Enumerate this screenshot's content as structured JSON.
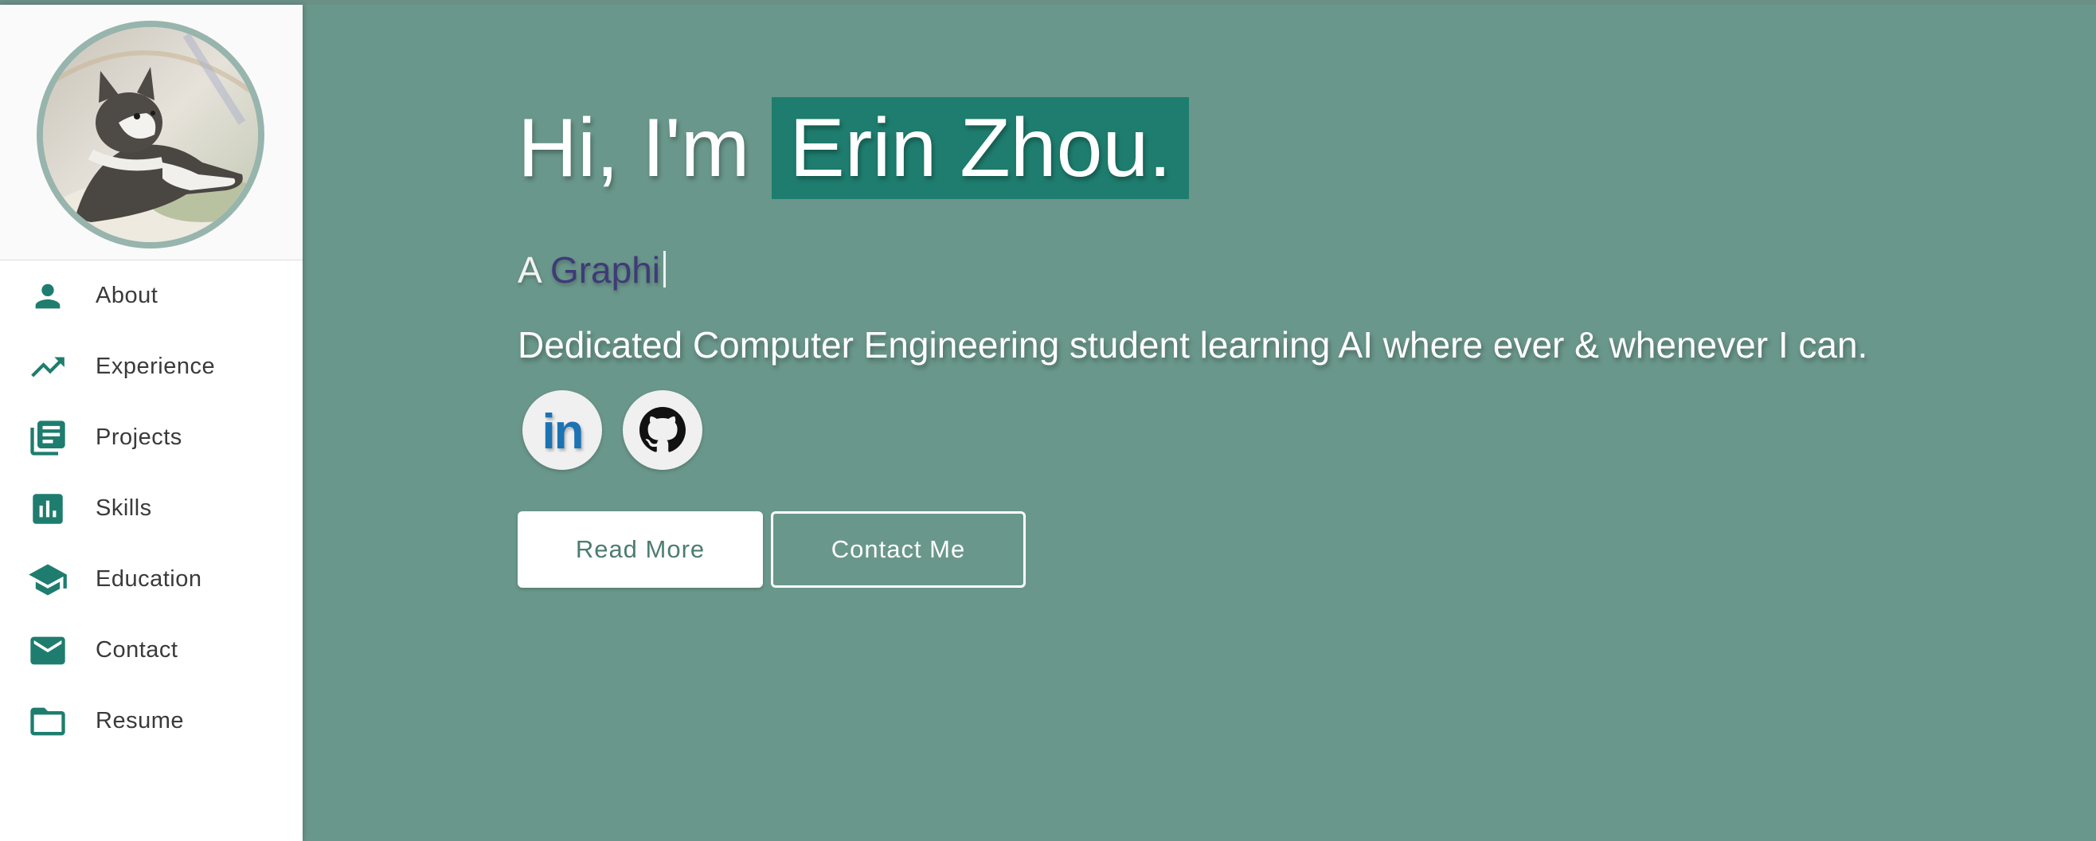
{
  "sidebar": {
    "avatar_alt": "Profile photo of a cat",
    "items": [
      {
        "label": "About",
        "icon": "person-icon"
      },
      {
        "label": "Experience",
        "icon": "trending-up-icon"
      },
      {
        "label": "Projects",
        "icon": "library-books-icon"
      },
      {
        "label": "Skills",
        "icon": "bar-chart-icon"
      },
      {
        "label": "Education",
        "icon": "graduation-cap-icon"
      },
      {
        "label": "Contact",
        "icon": "mail-icon"
      },
      {
        "label": "Resume",
        "icon": "folder-icon"
      }
    ]
  },
  "hero": {
    "greeting": "Hi, I'm",
    "name": "Erin Zhou.",
    "role_prefix": "A",
    "role_typed": "Graphi",
    "tagline": "Dedicated Computer Engineering student learning AI where ever & whenever I can.",
    "socials": [
      {
        "name": "linkedin-icon",
        "text": "in"
      },
      {
        "name": "github-icon"
      }
    ],
    "read_more_label": "Read More",
    "contact_label": "Contact Me"
  },
  "colors": {
    "accent": "#1e7d6e",
    "main_background": "#6a978b",
    "avatar_ring": "#97b4ad",
    "role_word": "#3f3a78"
  }
}
